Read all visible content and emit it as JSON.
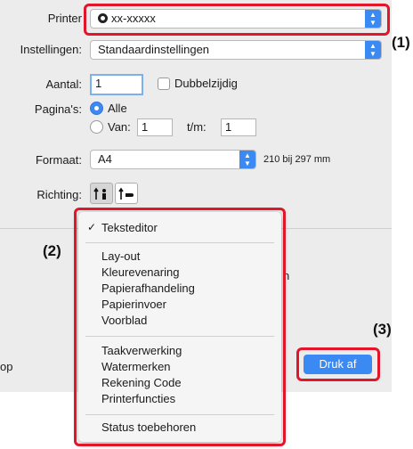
{
  "printer": {
    "label": "Printer",
    "value": "xx-xxxxx"
  },
  "presets": {
    "label": "Instellingen:",
    "value": "Standaardinstellingen"
  },
  "copies": {
    "label": "Aantal:",
    "value": "1",
    "duplex_label": "Dubbelzijdig"
  },
  "pages": {
    "label": "Pagina's:",
    "all_label": "Alle",
    "from_label": "Van:",
    "from_value": "1",
    "to_label": "t/m:",
    "to_value": "1"
  },
  "paper": {
    "label": "Formaat:",
    "value": "A4",
    "size_text": "210 bij 297 mm"
  },
  "orientation": {
    "label": "Richting:"
  },
  "menu": {
    "checked_item": "Teksteditor",
    "group1": [
      "Lay-out",
      "Kleurevenaring",
      "Papierafhandeling",
      "Papierinvoer",
      "Voorblad"
    ],
    "group2": [
      "Taakverwerking",
      "Watermerken",
      "Rekening Code",
      "Printerfuncties"
    ],
    "group3": [
      "Status toebehoren"
    ]
  },
  "partial_text": {
    "left_bottom": "op",
    "right_mid": "n"
  },
  "print_button": "Druk af",
  "callouts": {
    "c1": "(1)",
    "c2": "(2)",
    "c3": "(3)"
  },
  "colors": {
    "accent": "#3b8af3",
    "highlight": "#e2152b",
    "panel": "#ececec"
  }
}
